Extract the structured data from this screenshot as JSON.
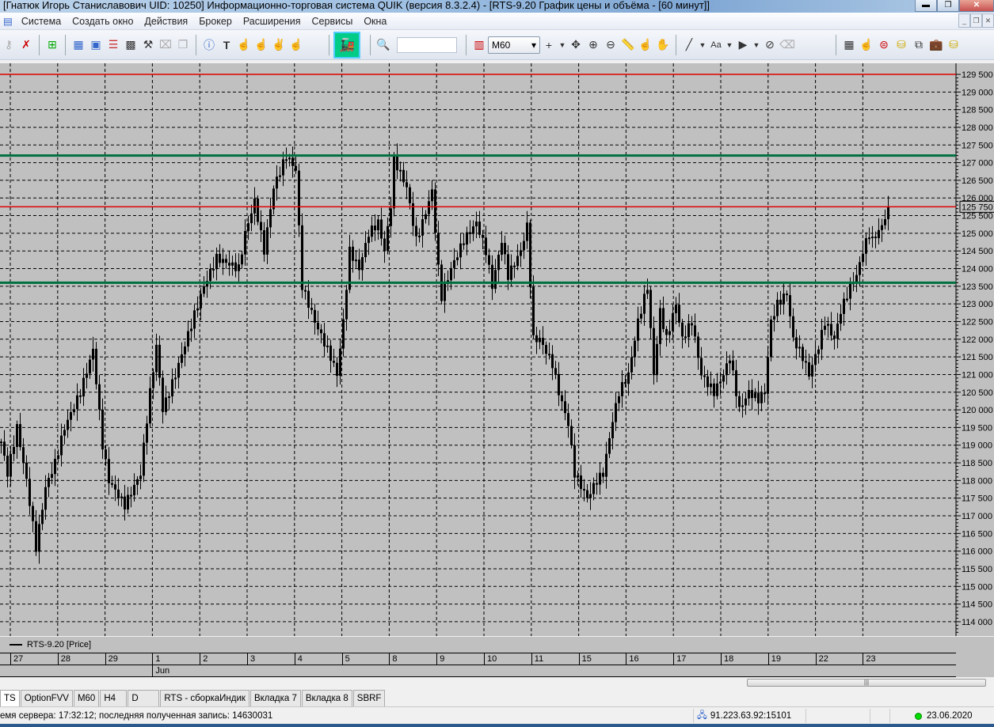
{
  "window": {
    "title": "[Гнатюк Игорь Станиславович UID: 10250] Информационно-торговая система QUIK (версия 8.3.2.4) - [RTS-9.20 График цены и объёма - [60 минут]]"
  },
  "menu": [
    "Система",
    "Создать окно",
    "Действия",
    "Брокер",
    "Расширения",
    "Сервисы",
    "Окна"
  ],
  "toolbar": {
    "interval": "M60",
    "search_value": ""
  },
  "chart_data": {
    "type": "candlestick",
    "instrument": "RTS-9.20 [Price]",
    "y_ticks": [
      129500,
      129000,
      128500,
      128000,
      127500,
      127000,
      126500,
      126000,
      125500,
      125000,
      124500,
      124000,
      123500,
      123000,
      122500,
      122000,
      121500,
      121000,
      120500,
      120000,
      119500,
      119000,
      118500,
      118000,
      117500,
      117000,
      116500,
      116000,
      115500,
      115000,
      114500,
      114000
    ],
    "ylim": [
      113800,
      129800
    ],
    "last_price": "125 750",
    "levels": [
      {
        "price": 129500,
        "color": "#e00000"
      },
      {
        "price": 127200,
        "color": "#007040"
      },
      {
        "price": 125750,
        "color": "#e00000"
      },
      {
        "price": 123600,
        "color": "#007040"
      }
    ],
    "days": [
      "27",
      "28",
      "29",
      "1",
      "2",
      "3",
      "4",
      "5",
      "8",
      "9",
      "10",
      "11",
      "15",
      "16",
      "17",
      "18",
      "19",
      "22",
      "23"
    ],
    "month": {
      "label": "Jun",
      "day_index": 3
    },
    "bars_per_day": 15,
    "close_path": [
      [
        0,
        119100
      ],
      [
        2,
        118200
      ],
      [
        5,
        119500
      ],
      [
        8,
        118000
      ],
      [
        11,
        116100
      ],
      [
        14,
        117800
      ],
      [
        17,
        118500
      ],
      [
        20,
        119500
      ],
      [
        25,
        120500
      ],
      [
        29,
        121700
      ],
      [
        32,
        119000
      ],
      [
        34,
        118000
      ],
      [
        39,
        117300
      ],
      [
        44,
        118200
      ],
      [
        47,
        120500
      ],
      [
        49,
        121800
      ],
      [
        51,
        120000
      ],
      [
        55,
        121000
      ],
      [
        61,
        122700
      ],
      [
        64,
        123500
      ],
      [
        68,
        124300
      ],
      [
        75,
        124000
      ],
      [
        77,
        125000
      ],
      [
        80,
        125900
      ],
      [
        83,
        124500
      ],
      [
        86,
        126300
      ],
      [
        90,
        127200
      ],
      [
        93,
        126800
      ],
      [
        95,
        123500
      ],
      [
        99,
        122500
      ],
      [
        104,
        121500
      ],
      [
        106,
        121000
      ],
      [
        108,
        122500
      ],
      [
        110,
        124500
      ],
      [
        113,
        124000
      ],
      [
        116,
        125000
      ],
      [
        119,
        125300
      ],
      [
        121,
        124500
      ],
      [
        123,
        125800
      ],
      [
        124,
        127100
      ],
      [
        128,
        126300
      ],
      [
        131,
        124800
      ],
      [
        133,
        125300
      ],
      [
        136,
        126200
      ],
      [
        138,
        124000
      ],
      [
        139,
        123200
      ],
      [
        142,
        124000
      ],
      [
        146,
        124800
      ],
      [
        150,
        125300
      ],
      [
        153,
        124500
      ],
      [
        155,
        123500
      ],
      [
        158,
        124800
      ],
      [
        160,
        123800
      ],
      [
        164,
        124500
      ],
      [
        166,
        125200
      ],
      [
        168,
        122000
      ],
      [
        170,
        122000
      ],
      [
        174,
        121300
      ],
      [
        176,
        120500
      ],
      [
        179,
        119600
      ],
      [
        181,
        118200
      ],
      [
        185,
        117500
      ],
      [
        188,
        118000
      ],
      [
        190,
        118200
      ],
      [
        193,
        119700
      ],
      [
        195,
        120500
      ],
      [
        198,
        121000
      ],
      [
        201,
        122500
      ],
      [
        204,
        123500
      ],
      [
        206,
        121000
      ],
      [
        208,
        122800
      ],
      [
        210,
        122000
      ],
      [
        213,
        123000
      ],
      [
        215,
        122000
      ],
      [
        218,
        122500
      ],
      [
        221,
        121000
      ],
      [
        225,
        120500
      ],
      [
        228,
        121000
      ],
      [
        230,
        121500
      ],
      [
        233,
        120000
      ],
      [
        236,
        120500
      ],
      [
        239,
        120300
      ],
      [
        241,
        120500
      ],
      [
        243,
        122500
      ],
      [
        245,
        123000
      ],
      [
        248,
        123300
      ],
      [
        250,
        122000
      ],
      [
        253,
        121500
      ],
      [
        255,
        121000
      ],
      [
        258,
        121800
      ],
      [
        260,
        122500
      ],
      [
        263,
        122000
      ],
      [
        265,
        122800
      ],
      [
        268,
        123500
      ],
      [
        270,
        123800
      ],
      [
        272,
        124500
      ],
      [
        274,
        125000
      ],
      [
        275,
        124800
      ],
      [
        278,
        125200
      ],
      [
        280,
        125750
      ]
    ]
  },
  "tabs": [
    "TS",
    "OptionFVV",
    "M60",
    "H4",
    "D",
    "RTS - сборкаИндик",
    "Вкладка 7",
    "Вкладка 8",
    "SBRF"
  ],
  "status": {
    "server": "емя сервера: 17:32:12; последняя полученная запись: 14630031",
    "connection": "91.223.63.92:15101",
    "date": "23.06.2020"
  }
}
